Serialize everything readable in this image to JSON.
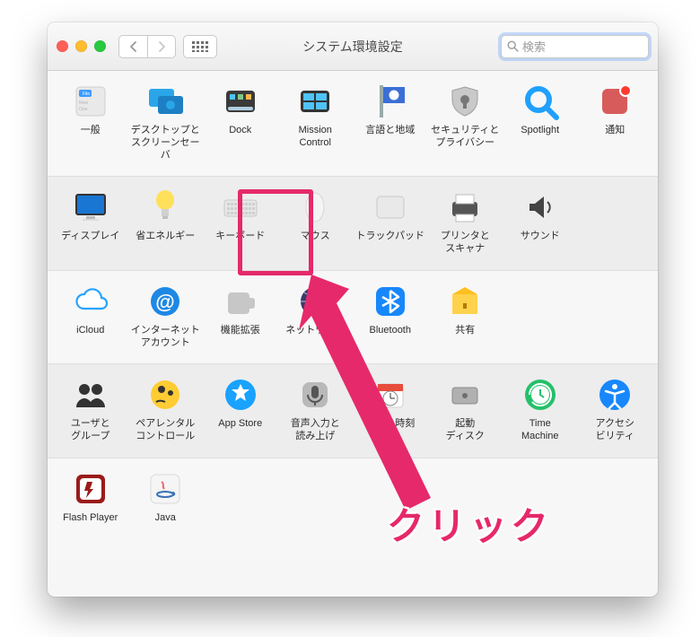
{
  "window_title": "システム環境設定",
  "search_placeholder": "検索",
  "annotation_text": "クリック",
  "annotation_font_size": 42,
  "rows": [
    [
      {
        "key": "general",
        "label": "一般"
      },
      {
        "key": "desktop",
        "label": "デスクトップと\nスクリーンセーバ"
      },
      {
        "key": "dock",
        "label": "Dock"
      },
      {
        "key": "mission",
        "label": "Mission\nControl"
      },
      {
        "key": "language",
        "label": "言語と地域"
      },
      {
        "key": "security",
        "label": "セキュリティと\nプライバシー"
      },
      {
        "key": "spotlight",
        "label": "Spotlight"
      },
      {
        "key": "notifications",
        "label": "通知"
      }
    ],
    [
      {
        "key": "displays",
        "label": "ディスプレイ"
      },
      {
        "key": "energy",
        "label": "省エネルギー"
      },
      {
        "key": "keyboard",
        "label": "キーボード"
      },
      {
        "key": "mouse",
        "label": "マウス"
      },
      {
        "key": "trackpad",
        "label": "トラックパッド"
      },
      {
        "key": "printers",
        "label": "プリンタと\nスキャナ"
      },
      {
        "key": "sound",
        "label": "サウンド"
      }
    ],
    [
      {
        "key": "icloud",
        "label": "iCloud"
      },
      {
        "key": "internet",
        "label": "インターネット\nアカウント"
      },
      {
        "key": "extensions",
        "label": "機能拡張"
      },
      {
        "key": "network",
        "label": "ネットワーク"
      },
      {
        "key": "bluetooth",
        "label": "Bluetooth"
      },
      {
        "key": "sharing",
        "label": "共有"
      }
    ],
    [
      {
        "key": "users",
        "label": "ユーザと\nグループ"
      },
      {
        "key": "parental",
        "label": "ペアレンタル\nコントロール"
      },
      {
        "key": "appstore",
        "label": "App Store"
      },
      {
        "key": "dictation",
        "label": "音声入力と\n読み上げ"
      },
      {
        "key": "datetime",
        "label": "日付と時刻"
      },
      {
        "key": "startup",
        "label": "起動\nディスク"
      },
      {
        "key": "timemachine",
        "label": "Time\nMachine"
      },
      {
        "key": "accessibility",
        "label": "アクセシ\nビリティ"
      }
    ],
    [
      {
        "key": "flash",
        "label": "Flash Player"
      },
      {
        "key": "java",
        "label": "Java"
      }
    ]
  ]
}
